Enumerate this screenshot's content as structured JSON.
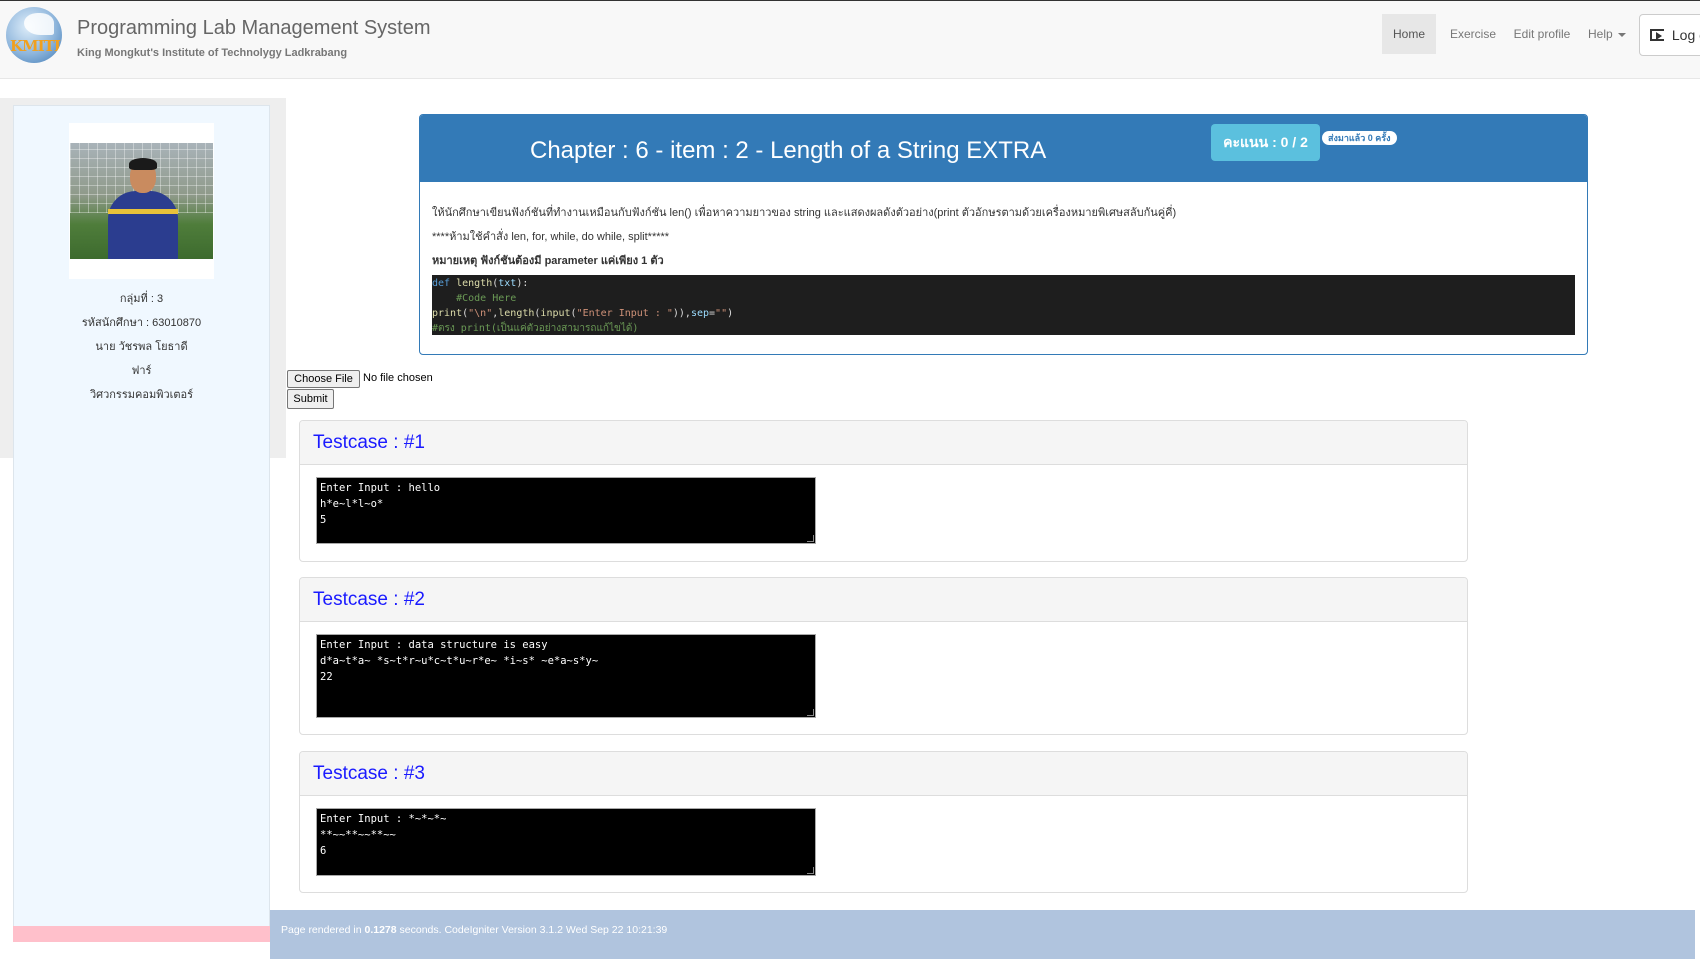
{
  "header": {
    "logo_text": "KMITL",
    "title": "Programming Lab Management System",
    "subtitle": "King Mongkut's Institute of Technolygy Ladkrabang",
    "nav": {
      "home": "Home",
      "exercise": "Exercise",
      "edit_profile": "Edit profile",
      "help": "Help",
      "logout": "Log out"
    }
  },
  "profile": {
    "group": "กลุ่มที่ : 3",
    "student_id": "รหัสนักศึกษา : 63010870",
    "name": "นาย วัชรพล โยธาดี",
    "nickname": "ฟาร์",
    "department": "วิศวกรรมคอมพิวเตอร์"
  },
  "problem": {
    "title": "Chapter : 6 - item : 2 - Length of a String EXTRA",
    "score": "คะแนน : 0 / 2",
    "submitted": "ส่งมาแล้ว 0 ครั้ง",
    "description": "ให้นักศึกษาเขียนฟังก์ชันที่ทำงานเหมือนกับฟังก์ชัน len() เพื่อหาความยาวของ string และแสดงผลดังตัวอย่าง(print ตัวอักษรตามด้วยเครื่องหมายพิเศษสลับกันคู่คี่)",
    "restriction": "****ห้ามใช้คำสั่ง len, for, while, do while, split*****",
    "note": "หมายเหตุ ฟังก์ชันต้องมี parameter แค่เพียง 1 ตัว",
    "code": {
      "def_kw": "def",
      "fn_name": "length",
      "param": "txt",
      "comment1": "#Code Here",
      "print_fn": "print",
      "newline_str": "\"\\n\"",
      "length_call": "length",
      "input_fn": "input",
      "prompt_str": "\"Enter Input : \"",
      "sep_kw": "sep",
      "empty_str": "\"\"",
      "comment2": "#ตรง print(เป็นแค่ตัวอย่างสามารถแก้ไขได้)"
    }
  },
  "upload": {
    "choose_file": "Choose File",
    "no_file": "No file chosen",
    "submit": "Submit"
  },
  "testcases": [
    {
      "title": "Testcase : #1",
      "output": "Enter Input : hello\nh*e~l*l~o*\n5"
    },
    {
      "title": "Testcase : #2",
      "output": "Enter Input : data structure is easy\nd*a~t*a~ *s~t*r~u*c~t*u~r*e~ *i~s* ~e*a~s*y~\n22"
    },
    {
      "title": "Testcase : #3",
      "output": "Enter Input : *~*~*~\n**~~**~~**~~\n6"
    }
  ],
  "footer": {
    "prefix": "Page rendered in ",
    "time": "0.1278",
    "suffix": " seconds. CodeIgniter Version 3.1.2 Wed Sep 22 10:21:39"
  },
  "colors": {
    "primary": "#337ab7",
    "info": "#5bc0de",
    "sidebar_bg": "#f0f8ff",
    "footer_bg": "#b0c4de",
    "testcase_title": "#1a1aff"
  }
}
